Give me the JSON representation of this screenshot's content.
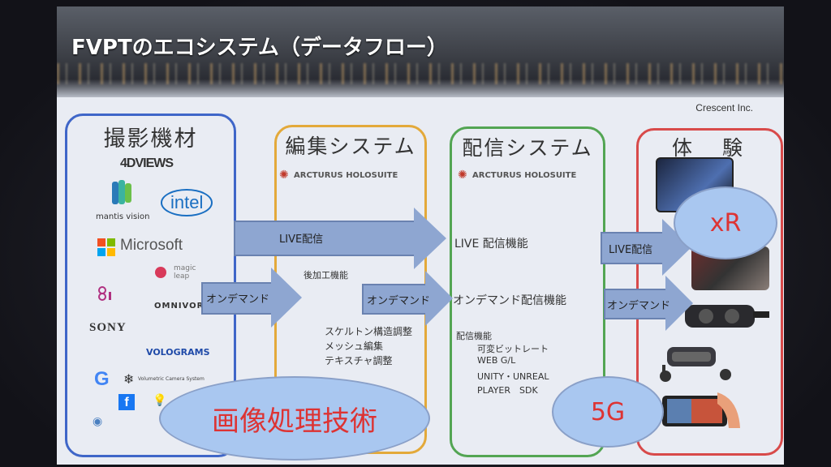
{
  "slide": {
    "title": "FVPTのエコシステム（データフロー）",
    "company": "Crescent Inc."
  },
  "columns": {
    "capture": {
      "heading": "撮影機材",
      "logos": [
        "4DVIEWS",
        "intel",
        "mantis vision",
        "Microsoft",
        "magic leap",
        "OMNIVOR",
        "SONY",
        "VOLOGRAMS",
        "Volumetric Camera System"
      ]
    },
    "edit": {
      "heading": "編集システム",
      "brand": "ARCTURUS HOLOSUITE",
      "post_label": "後加工機能",
      "features": [
        "スケルトン構造調整",
        "メッシュ編集",
        "テキスチャ調整"
      ]
    },
    "delivery": {
      "heading": "配信システム",
      "brand": "ARCTURUS HOLOSUITE",
      "live": "LIVE 配信機能",
      "ondemand": "オンデマンド配信機能",
      "features_title": "配信機能",
      "features": [
        "可変ビットレート",
        "WEB G/L",
        "UNITY・UNREAL",
        "PLAYER　SDK"
      ]
    },
    "experience": {
      "heading": "体　験"
    }
  },
  "arrows": {
    "live1": "LIVE配信",
    "ondemand1": "オンデマンド",
    "ondemand2": "オンデマンド",
    "live2": "LIVE配信",
    "ondemand3": "オンデマンド"
  },
  "ovals": {
    "image_processing": "画像処理技術",
    "fiveg": "5G",
    "xr": "xR"
  },
  "colors": {
    "capture": "#3f66c8",
    "edit": "#e3a93a",
    "delivery": "#53a553",
    "experience": "#d84a4a",
    "arrow": "#8ea6d1",
    "oval": "#a9c7f0",
    "oval_text": "#dd3333"
  },
  "icons": [
    "google-icon",
    "snowflake-icon",
    "facebook-icon",
    "lightbulb-icon",
    "webcam-icon",
    "arcturus-icon",
    "vr-headset-icon",
    "smartphone-icon"
  ]
}
